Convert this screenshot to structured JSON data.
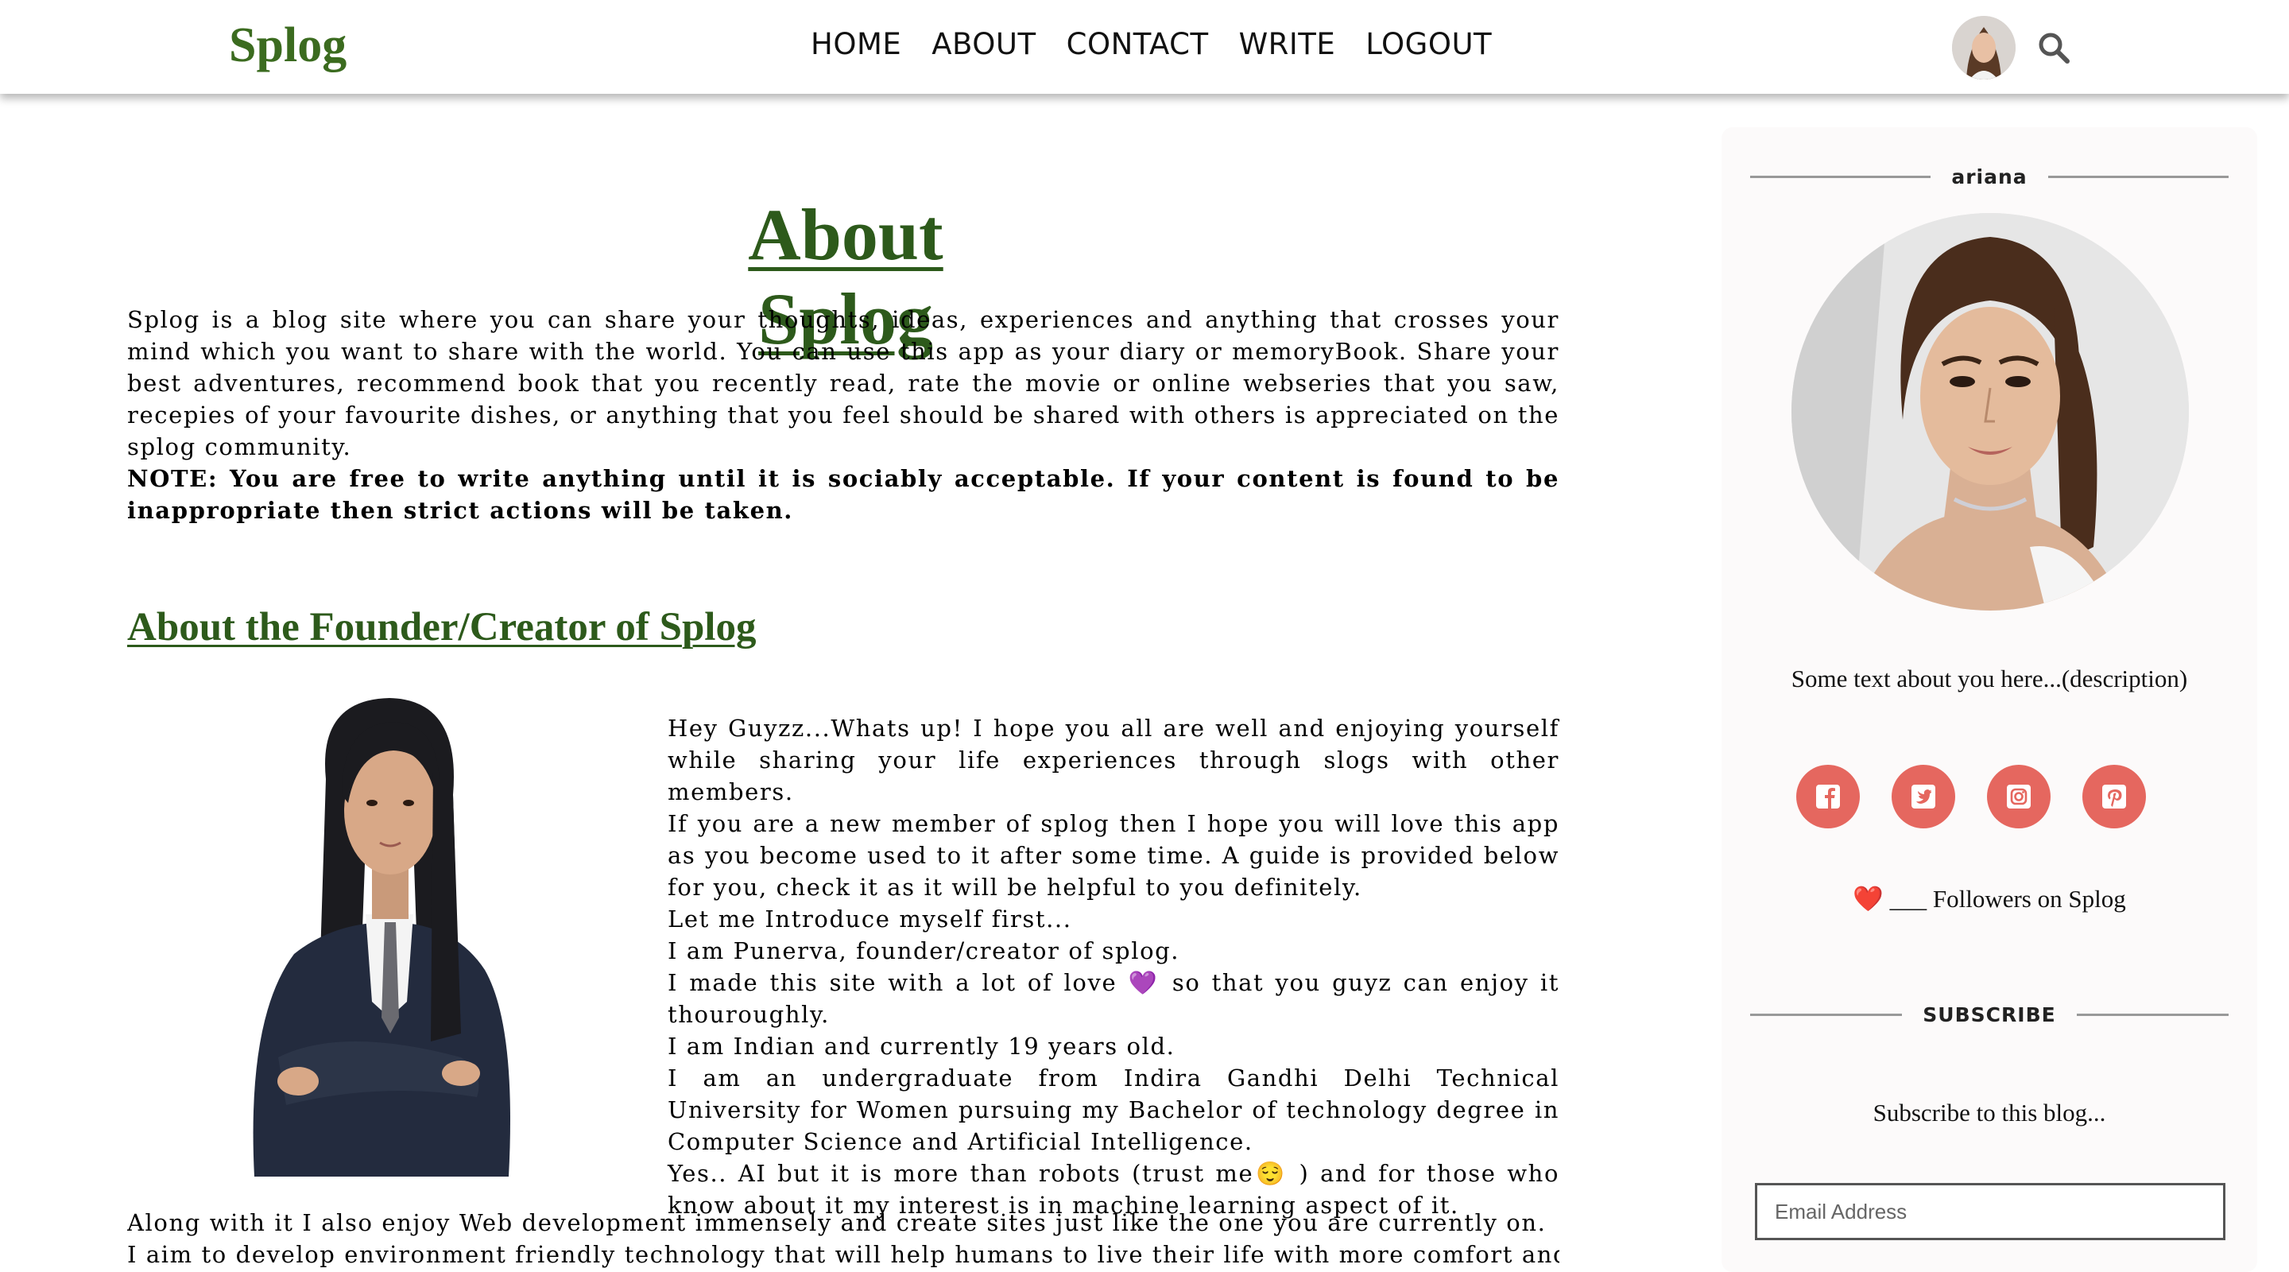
{
  "nav": {
    "logo": "Splog",
    "links": [
      "HOME",
      "ABOUT",
      "CONTACT",
      "WRITE",
      "LOGOUT"
    ]
  },
  "main": {
    "title": "About Splog",
    "intro": "Splog is a blog site where you can share your thoughts, ideas, experiences and anything that crosses your mind which you want to share with the world. You can use this app as your diary or memoryBook. Share your best adventures, recommend book that you recently read, rate the movie or online webseries that you saw, recepies of your favourite dishes, or anything that you feel should be shared with others is appreciated on the splog community.",
    "note": "NOTE: You are free to write anything until it is sociably acceptable. If your content is found to be inappropriate then strict actions will be taken.",
    "founder_heading": "About the Founder/Creator of Splog",
    "founder_lines": [
      "Hey Guyzz...Whats up! I hope you all are well and enjoying yourself while sharing your life experiences through slogs with other members.",
      "If you are a new member of splog then I hope you will love this app as you become used to it after some time. A guide is provided below for you, check it as it will be helpful to you definitely.",
      "Let me Introduce myself first...",
      "I am Punerva, founder/creator of splog.",
      "I made this site with a lot of love 💜  so that you guyz can enjoy it thouroughly.",
      "I am Indian and currently 19 years old.",
      "I am an undergraduate from Indira Gandhi Delhi Technical University for Women pursuing my Bachelor of technology degree in Computer Science and Artificial Intelligence.",
      "Yes.. AI but it is more than robots (trust me😌 ) and for those who know about it my interest is in machine learning aspect of it."
    ],
    "bottom_lines": [
      "Along with it I also enjoy Web development immensely and create sites just like the one you are currently on.",
      "I aim to develop environment friendly technology that will help humans to live their life with more comfort and take care"
    ]
  },
  "sidebar": {
    "username": "ariana",
    "description": "Some text about you here...(description)",
    "social_icons": [
      "facebook-icon",
      "twitter-icon",
      "instagram-icon",
      "pinterest-icon"
    ],
    "followers_heart": "❤️",
    "followers_text": "___ Followers on Splog",
    "subscribe_heading": "SUBSCRIBE",
    "subscribe_text": "Subscribe to this blog...",
    "email_placeholder": "Email Address"
  },
  "colors": {
    "brand_green": "#3b6b1f",
    "heading_green": "#2d5a1b",
    "social_red": "#e5675f"
  }
}
